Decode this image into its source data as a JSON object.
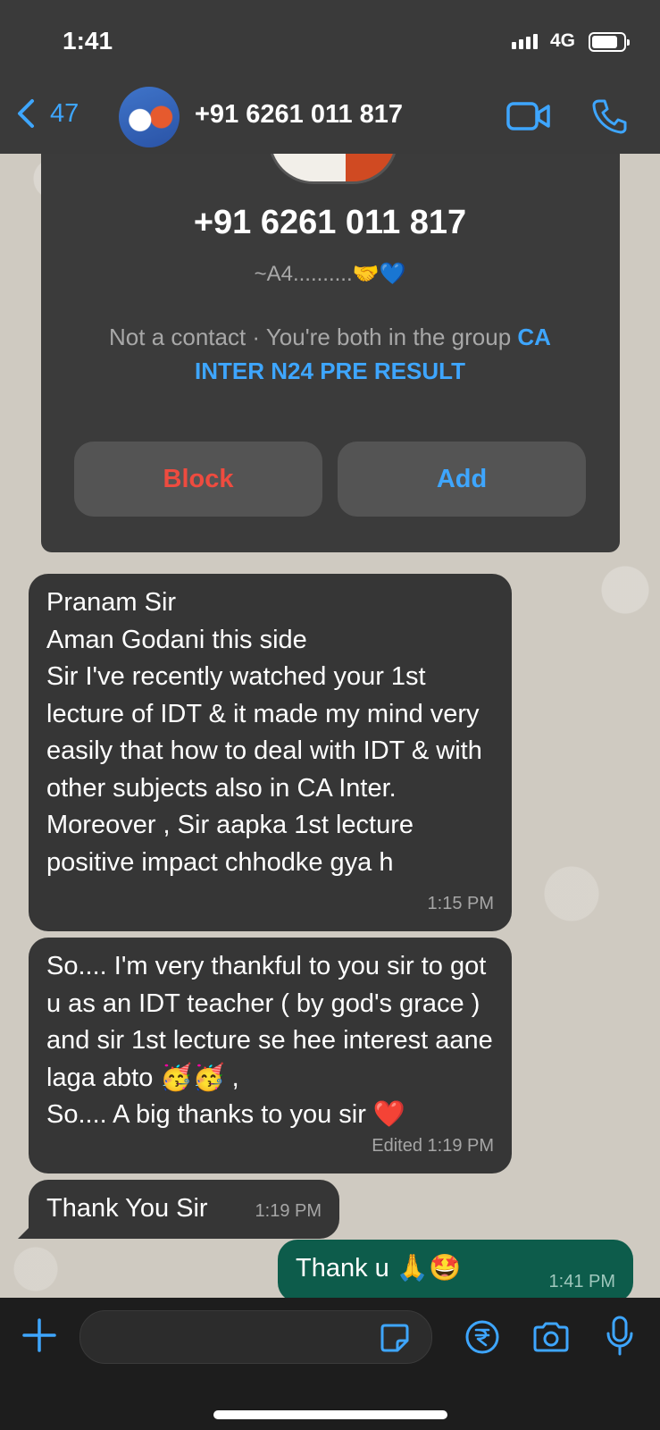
{
  "status_bar": {
    "time": "1:41",
    "network": "4G"
  },
  "header": {
    "back_count": "47",
    "contact_name": "+91 6261 011 817"
  },
  "contact_card": {
    "number": "+91 6261 011 817",
    "about": "~A4..........",
    "about_emojis": "🤝💙",
    "note_prefix": "Not a contact · You're both in the group ",
    "group_name": "CA INTER N24 PRE RESULT",
    "block_label": "Block",
    "add_label": "Add"
  },
  "messages": [
    {
      "direction": "incoming",
      "text": "Pranam Sir\nAman Godani this side\nSir I've recently watched your 1st lecture of IDT & it made my mind very easily that how to deal with IDT & with other subjects also  in CA Inter. Moreover , Sir aapka 1st lecture positive impact chhodke gya h",
      "time": "1:15 PM"
    },
    {
      "direction": "incoming",
      "text": "So.... I'm very thankful to you sir to got u as an IDT teacher ( by god's grace ) and sir 1st lecture se hee interest aane laga abto 🥳🥳 ,\nSo.... A big thanks to you sir ❤️",
      "time": "Edited  1:19 PM"
    },
    {
      "direction": "incoming",
      "text": "Thank You Sir",
      "time": "1:19 PM"
    },
    {
      "direction": "outgoing",
      "text": "Thank u 🙏🤩",
      "time": "1:41 PM"
    }
  ],
  "colors": {
    "accent": "#3ea6ff",
    "block_red": "#ee4b3f",
    "outgoing_bubble": "#0d5c4b",
    "incoming_bubble": "#363636"
  }
}
